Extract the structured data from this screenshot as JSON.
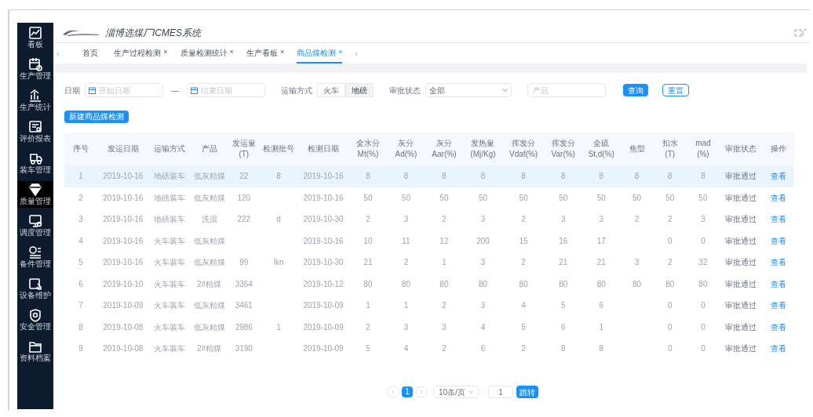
{
  "sidebar": {
    "items": [
      {
        "label": "看板",
        "selected": false
      },
      {
        "label": "生产管理",
        "selected": false
      },
      {
        "label": "生产统计",
        "selected": false
      },
      {
        "label": "评价报表",
        "selected": false
      },
      {
        "label": "装车管理",
        "selected": false
      },
      {
        "label": "质量管理",
        "selected": true
      },
      {
        "label": "调度管理",
        "selected": false
      },
      {
        "label": "备件管理",
        "selected": false
      },
      {
        "label": "设备维护",
        "selected": false
      },
      {
        "label": "安全管理",
        "selected": false
      },
      {
        "label": "资料档案",
        "selected": false
      }
    ]
  },
  "header": {
    "title": "淄博选煤厂ICMES系统"
  },
  "tabs_prev": "‹",
  "tabs_next": "›",
  "tabs": [
    {
      "label": "首页",
      "selected": false
    },
    {
      "label": "生产过程检测",
      "close": "×",
      "selected": false
    },
    {
      "label": "质量检测统计",
      "close": "×",
      "selected": false
    },
    {
      "label": "生产看板",
      "close": "×",
      "selected": false
    },
    {
      "label": "商品煤检测",
      "close": "×",
      "selected": true
    }
  ],
  "filters": {
    "date_label": "日期",
    "start_placeholder": "开始日期",
    "range_separator": "—",
    "end_placeholder": "结束日期",
    "transport_label": "运输方式",
    "transport_options": [
      {
        "label": "火车",
        "selected": false
      },
      {
        "label": "地磅",
        "selected": true
      }
    ],
    "status_label": "审批状态",
    "status_value": "全部",
    "product_placeholder": "产品",
    "search_button": "查询",
    "reset_button": "重置"
  },
  "new_button": "新建商品煤检测",
  "table": {
    "columns": [
      {
        "label": "序号",
        "kind": "text"
      },
      {
        "label": "发运日期",
        "kind": "text"
      },
      {
        "label": "运输方式",
        "kind": "text"
      },
      {
        "label": "产品",
        "kind": "text"
      },
      {
        "label": "发运量\n(T)",
        "kind": "text"
      },
      {
        "label": "检测批号",
        "kind": "text"
      },
      {
        "label": "检测日期",
        "kind": "text"
      },
      {
        "label": "全水分\nMt(%)",
        "kind": "text"
      },
      {
        "label": "灰分\nAd(%)",
        "kind": "text"
      },
      {
        "label": "灰分\nAar(%)",
        "kind": "text"
      },
      {
        "label": "发热量\n(Mj/Kg)",
        "kind": "text"
      },
      {
        "label": "挥发分\nVdaf(%)",
        "kind": "text"
      },
      {
        "label": "挥发分\nVar(%)",
        "kind": "text"
      },
      {
        "label": "全硫\nSt,d(%)",
        "kind": "text"
      },
      {
        "label": "焦型",
        "kind": "text"
      },
      {
        "label": "扣水\n(T)",
        "kind": "text"
      },
      {
        "label": "mad\n(%)",
        "kind": "text"
      },
      {
        "label": "审批状态",
        "kind": "text"
      },
      {
        "label": "操作",
        "kind": "action"
      }
    ],
    "rows": [
      {
        "selected": true,
        "cells": [
          "1",
          "2019-10-16",
          "地磅装车",
          "低灰精煤",
          "22",
          "8",
          "2019-10-16",
          "8",
          "8",
          "8",
          "8",
          "8",
          "8",
          "8",
          "8",
          "8",
          "8",
          "审批通过",
          "查看"
        ]
      },
      {
        "selected": false,
        "cells": [
          "2",
          "2019-10-16",
          "地磅装车",
          "低灰精煤",
          "120",
          null,
          "2019-10-16",
          "50",
          "50",
          "50",
          "50",
          "50",
          "50",
          "50",
          "50",
          "50",
          "50",
          "审批通过",
          "查看"
        ]
      },
      {
        "selected": false,
        "cells": [
          "3",
          "2019-10-16",
          "地磅装车",
          "洗混",
          "222",
          "d",
          "2019-10-30",
          "2",
          "3",
          "2",
          "3",
          "2",
          "3",
          "3",
          "2",
          "2",
          "3",
          "审批通过",
          "查看"
        ]
      },
      {
        "selected": false,
        "cells": [
          "4",
          "2019-10-16",
          "火车装车",
          "低灰精煤",
          null,
          null,
          "2019-10-16",
          "10",
          "11",
          "12",
          "200",
          "15",
          "16",
          "17",
          null,
          "0",
          "0",
          "审批通过",
          "查看"
        ]
      },
      {
        "selected": false,
        "cells": [
          "5",
          "2019-10-16",
          "火车装车",
          "低灰精煤",
          "99",
          "lkn",
          "2019-10-30",
          "21",
          "2",
          "1",
          "3",
          "2",
          "21",
          "21",
          "3",
          "2",
          "32",
          "审批通过",
          "查看"
        ]
      },
      {
        "selected": false,
        "cells": [
          "6",
          "2019-10-10",
          "火车装车",
          "2#精煤",
          "3364",
          null,
          "2019-10-12",
          "80",
          "80",
          "80",
          "80",
          "80",
          "80",
          "80",
          "80",
          "80",
          "80",
          "审批通过",
          "查看"
        ]
      },
      {
        "selected": false,
        "cells": [
          "7",
          "2019-10-09",
          "火车装车",
          "低灰精煤",
          "3461",
          null,
          "2019-10-09",
          "1",
          "1",
          "2",
          "3",
          "4",
          "5",
          "6",
          null,
          "0",
          "0",
          "审批通过",
          "查看"
        ]
      },
      {
        "selected": false,
        "cells": [
          "8",
          "2019-10-08",
          "火车装车",
          "低灰精煤",
          "2986",
          "1",
          "2019-10-09",
          "2",
          "3",
          "3",
          "4",
          "5",
          "6",
          "1",
          null,
          "0",
          "0",
          "审批通过",
          "查看"
        ]
      },
      {
        "selected": false,
        "cells": [
          "9",
          "2019-10-08",
          "火车装车",
          "2#精煤",
          "3190",
          null,
          "2019-10-09",
          "5",
          "4",
          "2",
          "6",
          "2",
          "8",
          "8",
          null,
          "0",
          "0",
          "审批通过",
          "查看"
        ]
      }
    ]
  },
  "pagination": {
    "prev": "‹",
    "pages": [
      {
        "label": "1",
        "selected": true
      }
    ],
    "next": "›",
    "page_size": "10条/页",
    "jump_value": "1",
    "jump_button": "跳转"
  }
}
